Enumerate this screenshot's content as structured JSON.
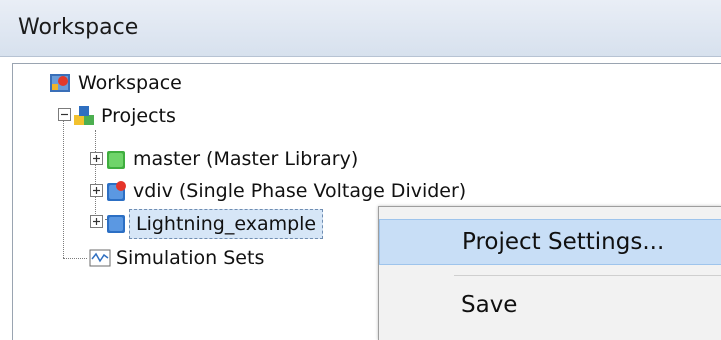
{
  "window": {
    "title": "Workspace"
  },
  "tree": {
    "root": {
      "label": "Workspace",
      "icon": "workspace-icon"
    },
    "projects": {
      "label": "Projects",
      "icon": "projects-icon"
    },
    "items": [
      {
        "label": "master (Master Library)",
        "icon": "library-cube-icon"
      },
      {
        "label": "vdiv (Single Phase Voltage Divider)",
        "icon": "project-cube-icon"
      },
      {
        "label": "Lightning_example",
        "icon": "project-cube-icon"
      }
    ],
    "simulation_sets": {
      "label": "Simulation Sets",
      "icon": "simulation-sets-icon"
    }
  },
  "context_menu": {
    "items": [
      {
        "label": "Project Settings..."
      },
      {
        "label": "Save"
      }
    ]
  }
}
